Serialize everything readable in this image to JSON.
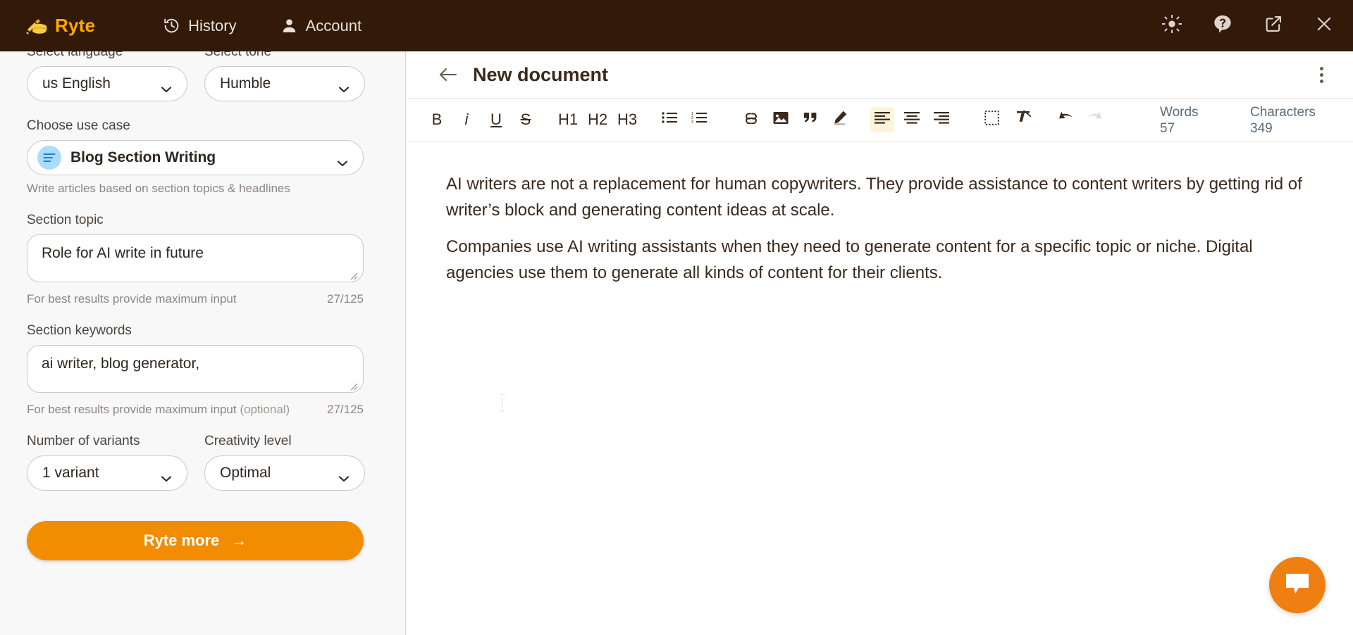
{
  "topbar": {
    "brand": "Ryte",
    "brand_color": "#ffa800",
    "bar_color": "#331a08",
    "nav": [
      {
        "label": "History",
        "icon": "history-icon"
      },
      {
        "label": "Account",
        "icon": "person-icon"
      }
    ],
    "actions": [
      {
        "name": "brightness-icon"
      },
      {
        "name": "help-icon"
      },
      {
        "name": "external-link-icon"
      },
      {
        "name": "close-icon"
      }
    ]
  },
  "sidebar": {
    "language": {
      "label": "Select language",
      "value": "us English"
    },
    "tone": {
      "label": "Select tone",
      "value": "Humble"
    },
    "use_case": {
      "label": "Choose use case",
      "value": "Blog Section Writing",
      "helper": "Write articles based on section topics & headlines"
    },
    "section_topic": {
      "label": "Section topic",
      "value": "Role for AI write in future",
      "helper": "For best results provide maximum input",
      "counter": "27/125"
    },
    "section_keywords": {
      "label": "Section keywords",
      "value": "ai writer, blog generator,",
      "helper": "For best results provide maximum input",
      "helper_optional": "(optional)",
      "counter": "27/125"
    },
    "variants": {
      "label": "Number of variants",
      "value": "1 variant"
    },
    "creativity": {
      "label": "Creativity level",
      "value": "Optimal"
    },
    "submit": {
      "label": "Ryte more",
      "arrow": "→",
      "color": "#f28c00"
    }
  },
  "document": {
    "title": "New document",
    "toolbar": {
      "bold": "B",
      "italic": "i",
      "underline": "U",
      "strike": "S",
      "h1": "H1",
      "h2": "H2",
      "h3": "H3"
    },
    "counters": {
      "words_label": "Words",
      "words_value": "57",
      "characters_label": "Characters",
      "characters_value": "349"
    },
    "paragraphs": [
      "AI writers are not a replacement for human copywriters. They provide assistance to content writers by getting rid of writer’s block and generating content ideas at scale.",
      "Companies use AI writing assistants when they need to generate content for a specific topic or niche. Digital agencies use them to generate all kinds of content for their clients."
    ]
  },
  "chat_widget": {
    "icon": "chat-bubble-icon",
    "color": "#ee7f10"
  }
}
